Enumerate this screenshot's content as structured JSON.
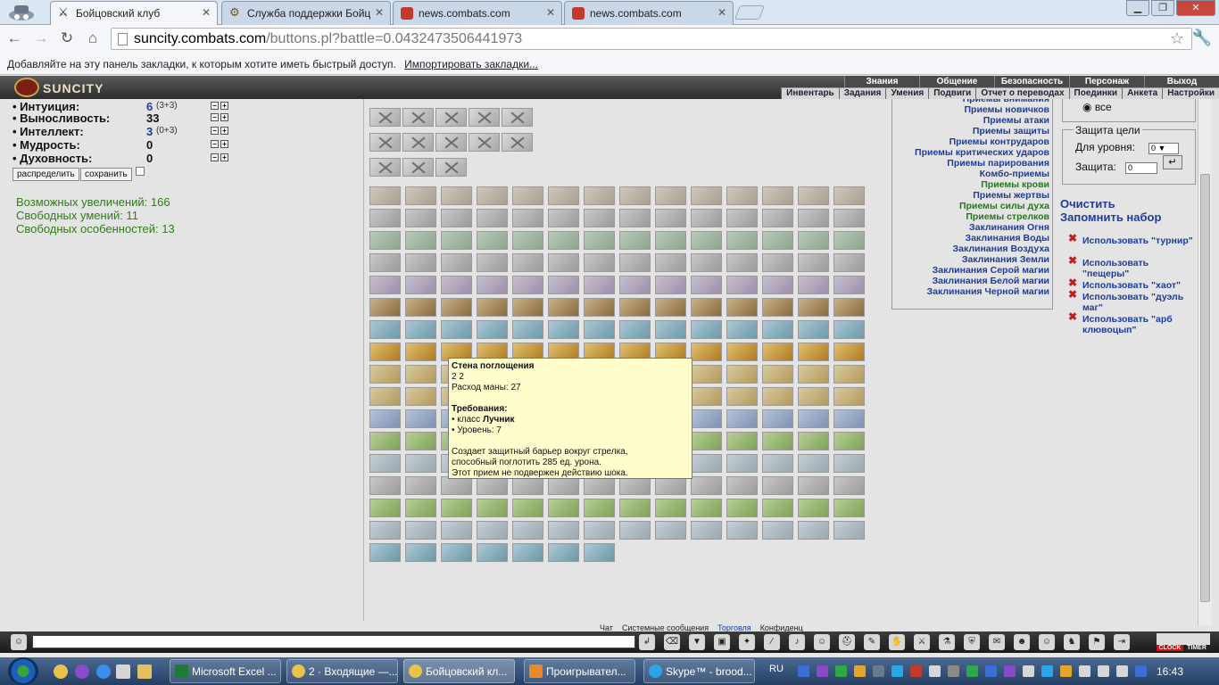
{
  "browser": {
    "tabs": [
      {
        "title": "Бойцовский клуб",
        "active": true
      },
      {
        "title": "Служба поддержки Бойц",
        "active": false
      },
      {
        "title": "news.combats.com",
        "active": false
      },
      {
        "title": "news.combats.com",
        "active": false
      }
    ],
    "url_host": "suncity.combats.com",
    "url_path": "/buttons.pl?battle=0.0432473506441973",
    "bookmarks_text": "Добавляйте на эту панель закладки, к которым хотите иметь быстрый доступ.",
    "bookmarks_link": "Импортировать закладки..."
  },
  "game": {
    "logo": "SUNCITY",
    "menu_top": [
      "Знания",
      "Общение",
      "Безопасность",
      "Персонаж",
      "Выход"
    ],
    "menu_sub": [
      "Инвентарь",
      "Задания",
      "Умения",
      "Подвиги",
      "Отчет о переводах",
      "Поединки",
      "Анкета",
      "Настройки"
    ]
  },
  "stats": [
    {
      "label": "• Интуиция:",
      "value": "6",
      "extra": "(3+3)",
      "blue": true
    },
    {
      "label": "• Выносливость:",
      "value": "33",
      "extra": "",
      "blue": false
    },
    {
      "label": "• Интеллект:",
      "value": "3",
      "extra": "(0+3)",
      "blue": true
    },
    {
      "label": "• Мудрость:",
      "value": "0",
      "extra": "",
      "blue": false
    },
    {
      "label": "• Духовность:",
      "value": "0",
      "extra": "",
      "blue": false
    }
  ],
  "stat_buttons": {
    "distribute": "распределить",
    "save": "сохранить"
  },
  "free": {
    "increases": "Возможных увеличений: 166",
    "skills": "Свободных умений: 11",
    "features": "Свободных особенностей: 13"
  },
  "tooltip": {
    "title": "Стена поглощения",
    "icons_line": "2   2",
    "mana": "Расход маны: 27",
    "req_title": "Требования:",
    "req_class_prefix": "• класс ",
    "req_class": "Лучник",
    "req_level": "• Уровень: 7",
    "desc1": "Создает защитный барьер вокруг стрелка,",
    "desc2": "способный поглотить 285 ед. урона.",
    "desc3": "Этот прием не подвержен действию шока."
  },
  "categories": [
    {
      "label": "Приемы внимания",
      "green": false
    },
    {
      "label": "Приемы новичков",
      "green": false
    },
    {
      "label": "Приемы атаки",
      "green": false
    },
    {
      "label": "Приемы защиты",
      "green": false
    },
    {
      "label": "Приемы контрударов",
      "green": false
    },
    {
      "label": "Приемы критических ударов",
      "green": false
    },
    {
      "label": "Приемы парирования",
      "green": false
    },
    {
      "label": "Комбо-приемы",
      "green": false
    },
    {
      "label": "Приемы крови",
      "green": true
    },
    {
      "label": "Приемы жертвы",
      "green": false
    },
    {
      "label": "Приемы силы духа",
      "green": true
    },
    {
      "label": "Приемы стрелков",
      "green": true
    },
    {
      "label": "Заклинания Огня",
      "green": false
    },
    {
      "label": "Заклинания Воды",
      "green": false
    },
    {
      "label": "Заклинания Воздуха",
      "green": false
    },
    {
      "label": "Заклинания Земли",
      "green": false
    },
    {
      "label": "Заклинания Серой магии",
      "green": false
    },
    {
      "label": "Заклинания Белой магии",
      "green": false
    },
    {
      "label": "Заклинания Черной магии",
      "green": false
    }
  ],
  "filter": {
    "radio_all": "все",
    "defense_legend": "Защита цели",
    "for_level_label": "Для уровня:",
    "for_level_value": "0",
    "defense_label": "Защита:",
    "defense_value": "0"
  },
  "actions": {
    "clear": "Очистить",
    "remember": "Запомнить набор"
  },
  "use_links": [
    "Использовать \"турнир\"",
    "Использовать \"пещеры\"",
    "Использовать \"хаот\"",
    "Использовать \"дуэль маг\"",
    "Использовать \"арб клювоцып\""
  ],
  "chat_tabs": [
    "Чат",
    "Системные сообщения",
    "Торговля",
    "Конфиденц"
  ],
  "clock": {
    "tab1": "CLOCK",
    "tab2": "TIMER"
  },
  "taskbar": {
    "tasks": [
      "Microsoft Excel ...",
      "2 · Входящие —...",
      "Бойцовский кл...",
      "Проигрывател...",
      "Skype™ - brood..."
    ],
    "lang": "RU",
    "time": "16:43"
  }
}
